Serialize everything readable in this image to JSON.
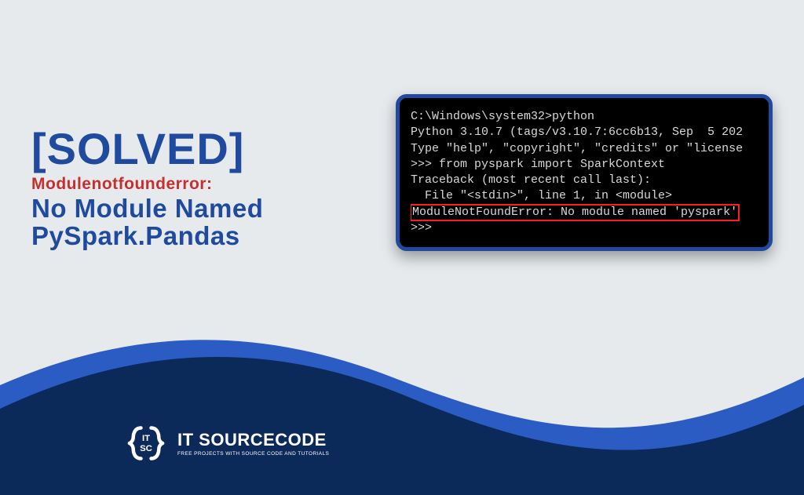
{
  "headline": {
    "solved": "[SOLVED]",
    "error_label": "Modulenotfounderror:",
    "line_a": "No Module Named",
    "line_b": "PySpark.Pandas"
  },
  "terminal": {
    "rows": [
      "C:\\Windows\\system32>python",
      "Python 3.10.7 (tags/v3.10.7:6cc6b13, Sep  5 202",
      "Type \"help\", \"copyright\", \"credits\" or \"license",
      ">>> from pyspark import SparkContext",
      "Traceback (most recent call last):",
      "  File \"<stdin>\", line 1, in <module>"
    ],
    "error_row": "ModuleNotFoundError: No module named 'pyspark'",
    "after": ">>>"
  },
  "brand": {
    "name": "IT SOURCECODE",
    "tagline": "FREE PROJECTS WITH SOURCE CODE AND TUTORIALS"
  }
}
